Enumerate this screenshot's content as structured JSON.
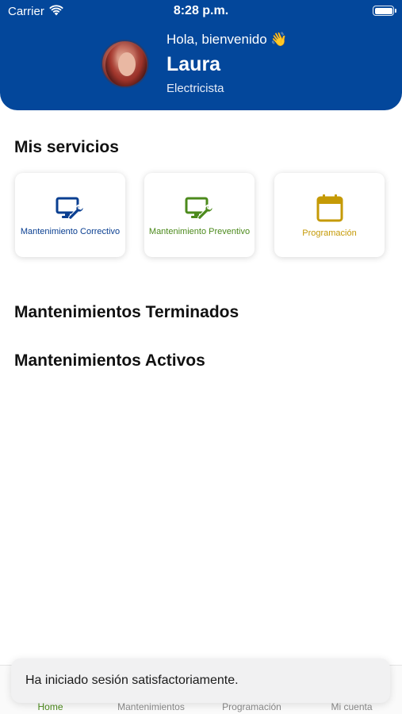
{
  "status_bar": {
    "carrier": "Carrier",
    "time": "8:28 p.m."
  },
  "header": {
    "greeting": "Hola, bienvenido 👋",
    "name": "Laura",
    "role": "Electricista"
  },
  "sections": {
    "services_title": "Mis servicios",
    "finished_title": "Mantenimientos Terminados",
    "active_title": "Mantenimientos Activos"
  },
  "services": [
    {
      "label": "Mantenimiento Correctivo",
      "icon": "monitor-wrench-icon",
      "color": "#0a3f91"
    },
    {
      "label": "Mantenimiento Preventivo",
      "icon": "monitor-wrench-icon",
      "color": "#4c8a1c"
    },
    {
      "label": "Programación",
      "icon": "calendar-icon",
      "color": "#c59a06"
    }
  ],
  "tabs": [
    {
      "label": "Home",
      "active": true,
      "color": "#4c8a1c"
    },
    {
      "label": "Mantenimientos"
    },
    {
      "label": "Programación"
    },
    {
      "label": "Mi cuenta"
    }
  ],
  "toast": {
    "message": "Ha iniciado sesión satisfactoriamente."
  },
  "colors": {
    "header": "#03479b",
    "primary_blue": "#0a3f91",
    "green": "#4c8a1c",
    "gold": "#c59a06"
  }
}
